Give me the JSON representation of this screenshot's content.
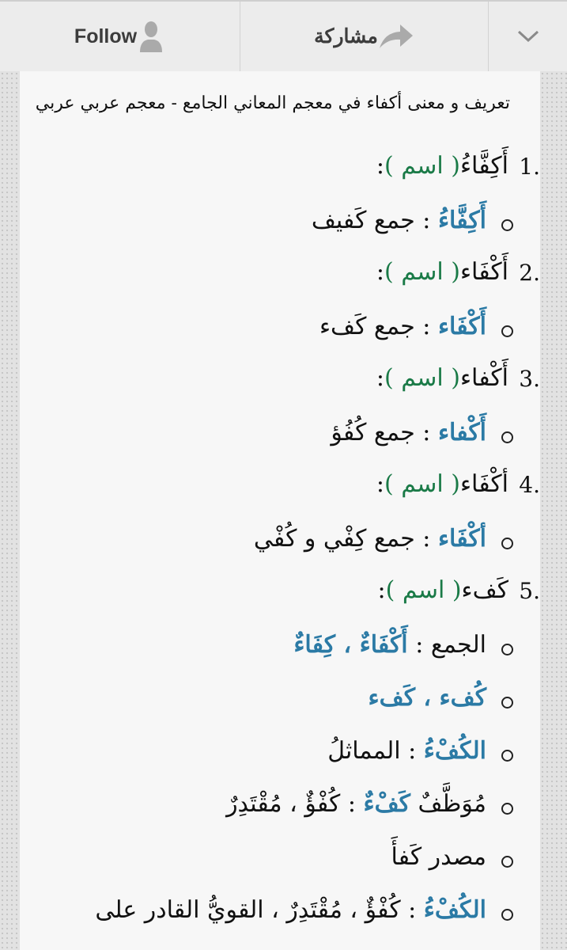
{
  "toolbar": {
    "follow_label": "Follow",
    "follow_icon": "person-icon",
    "share_label": "مشاركة",
    "share_icon": "share-arrow-icon",
    "menu_icon": "chevron-down-icon"
  },
  "page": {
    "title": "تعريف و معنى أكفاء في معجم المعاني الجامع - معجم عربي عربي"
  },
  "entries": [
    {
      "number": "1.",
      "word": "أَكِفَّاءُ",
      "pos": "( اسم )",
      "colon": ":",
      "definitions": [
        {
          "term": "أَكِفَّاءُ",
          "text": " : جمع كَفيف"
        }
      ]
    },
    {
      "number": "2.",
      "word": "أَكْفَاء",
      "pos": "( اسم )",
      "colon": ":",
      "definitions": [
        {
          "term": "أَكْفَاء",
          "text": " : جمع كَفء"
        }
      ]
    },
    {
      "number": "3.",
      "word": "أَكْفاء",
      "pos": "( اسم )",
      "colon": ":",
      "definitions": [
        {
          "term": "أَكْفاء",
          "text": " : جمع كُفُؤ"
        }
      ]
    },
    {
      "number": "4.",
      "word": "أكْفَاء",
      "pos": "( اسم )",
      "colon": ":",
      "definitions": [
        {
          "term": "أكْفَاء",
          "text": " : جمع كِفْي و كُفْي"
        }
      ]
    },
    {
      "number": "5.",
      "word": "كَفء",
      "pos": "( اسم )",
      "colon": ":",
      "definitions": [
        {
          "prefix": "الجمع : ",
          "term": "أَكْفَاءٌ ، كِفَاءٌ",
          "text": ""
        },
        {
          "term": "كُفء ، كَفء",
          "text": ""
        },
        {
          "term": "الكُفْءُ",
          "text": " : المماثلُ"
        },
        {
          "prefix": "مُوَظَّفٌ ",
          "term": "كَفْءٌ",
          "text": " : كُفْؤٌ ، مُقْتَدِرٌ"
        },
        {
          "prefix": "مصدر كَفأَ",
          "term": "",
          "text": ""
        },
        {
          "term": "الكُفْءُ",
          "text": " : كُفْؤٌ ، مُقْتَدِرٌ ، القويُّ القادر على"
        }
      ]
    }
  ]
}
